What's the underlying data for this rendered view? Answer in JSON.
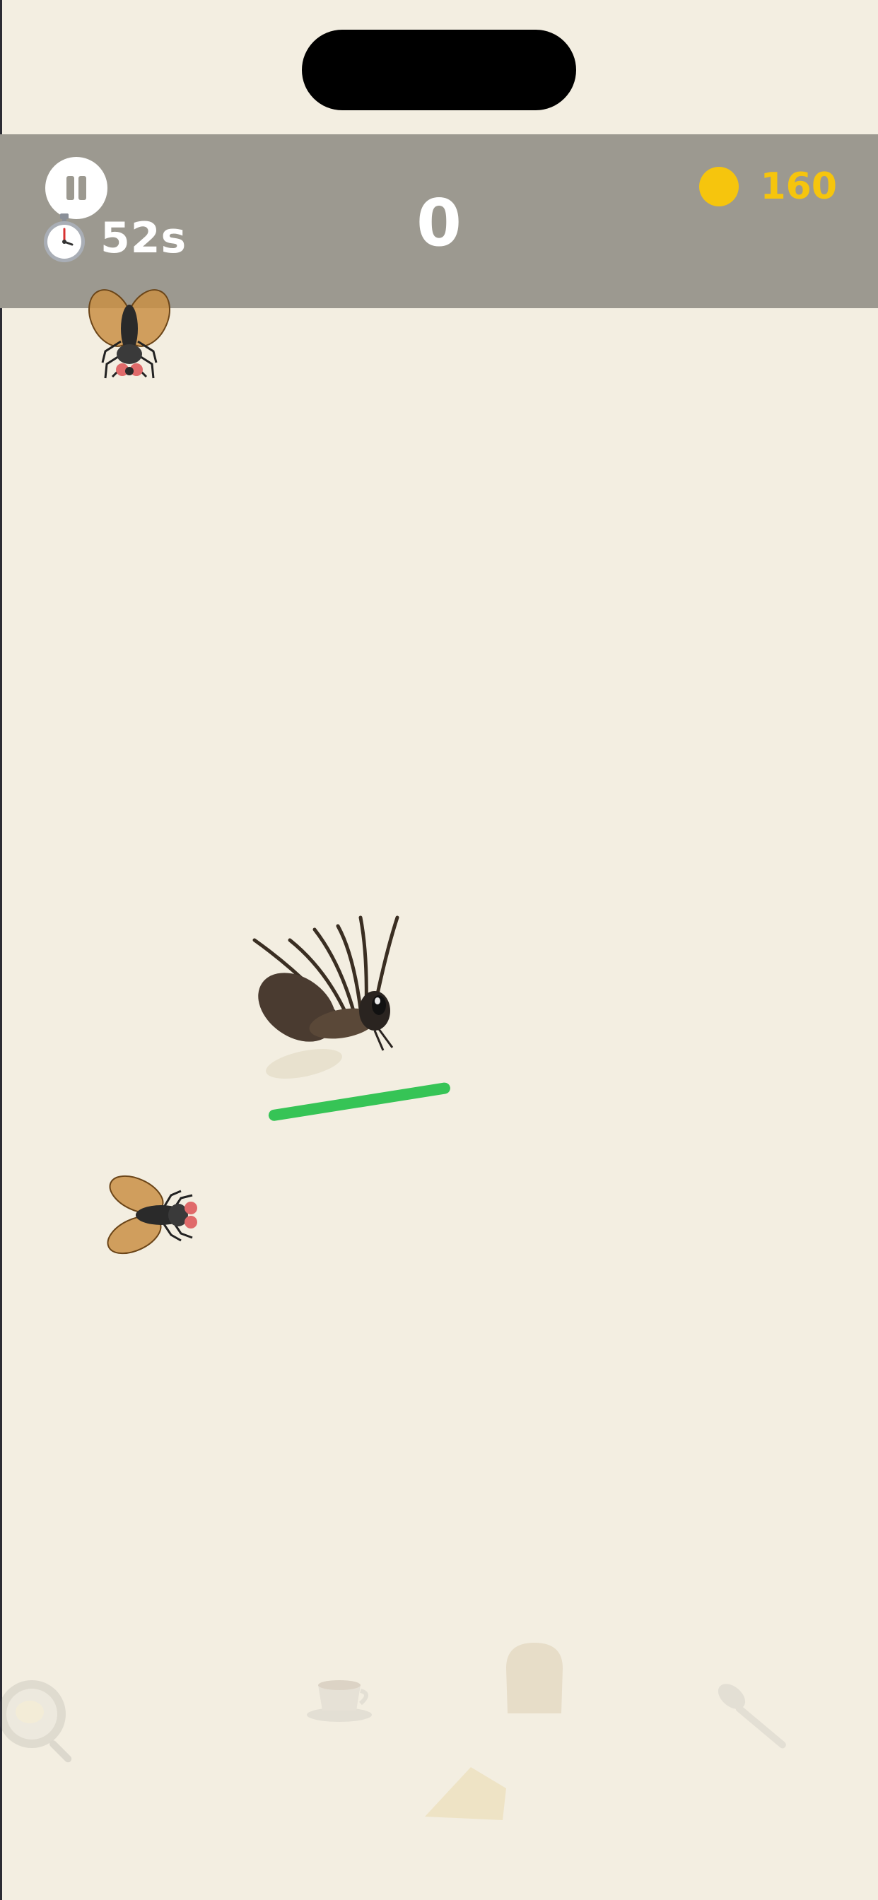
{
  "hud": {
    "timer_text": "52s",
    "score": "0",
    "coins": "160",
    "pause_icon": "pause-icon",
    "timer_icon": "stopwatch-icon",
    "coin_icon": "coin-icon"
  },
  "bugs": [
    {
      "type": "fly",
      "icon": "fly-icon"
    },
    {
      "type": "mosquito",
      "icon": "mosquito-icon",
      "health": 1.0
    },
    {
      "type": "fly",
      "icon": "fly-icon"
    }
  ],
  "background_items": [
    "frying-pan-icon",
    "coffee-cup-icon",
    "bread-icon",
    "cheese-icon",
    "spoon-icon"
  ],
  "colors": {
    "background": "#f3eee1",
    "hud_bar": "#9c9990",
    "coin": "#f6c50d",
    "health": "#36c456",
    "text": "#ffffff"
  }
}
